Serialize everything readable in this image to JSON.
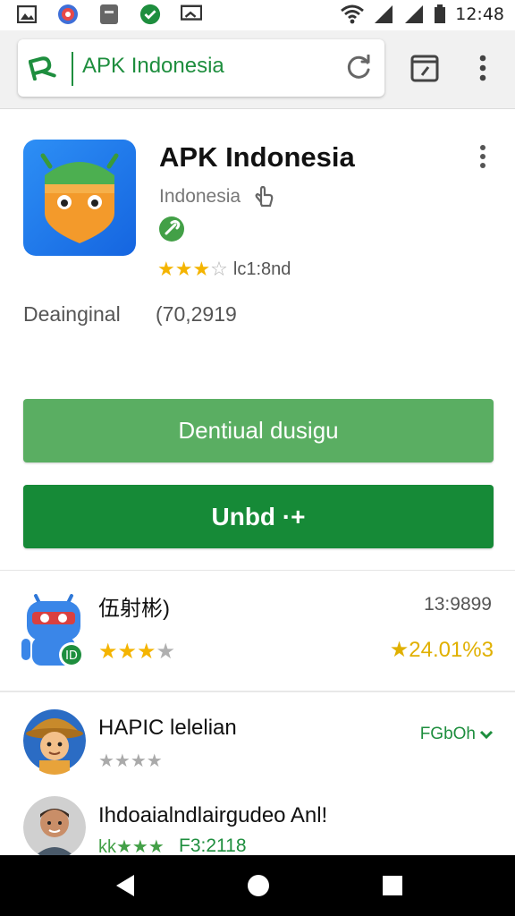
{
  "status_bar": {
    "time": "12:48",
    "icons": [
      "gallery-icon",
      "notification-badge-icon",
      "sd-card-icon",
      "check-icon",
      "cast-icon",
      "wifi-icon",
      "signal-icon",
      "signal-icon",
      "battery-icon"
    ]
  },
  "browser": {
    "url_text": "APK Indonesia",
    "logo": "apk-logo-icon",
    "reload": "reload-icon",
    "tabs": "tabs-icon",
    "menu": "more-vert-icon"
  },
  "app": {
    "title": "APK Indonesia",
    "developer": "Indonesia",
    "rating_stars": 3,
    "rating_text": "lc1:8nd",
    "meta_label": "Deainginal",
    "meta_value": "(70,2919",
    "button_primary": "Dentiual dusigu",
    "button_install": "Unbd ·+"
  },
  "list": [
    {
      "title": "伍射彬)",
      "meta_right": "13:9899",
      "stars": 3,
      "rating": "★24.01%3"
    },
    {
      "title": "HAPIC lelelian",
      "link": "FGbOh",
      "stars": 4
    },
    {
      "title": "Ihdoaialndlairgudeo Anl!",
      "green_stars": "kk★★★",
      "meta": "F3:2118"
    }
  ],
  "colors": {
    "accent_green": "#1e8e3e",
    "button_light": "#5aae62",
    "button_dark": "#168a37",
    "star_gold": "#f4b400",
    "icon_blue": "#1e7be9"
  }
}
